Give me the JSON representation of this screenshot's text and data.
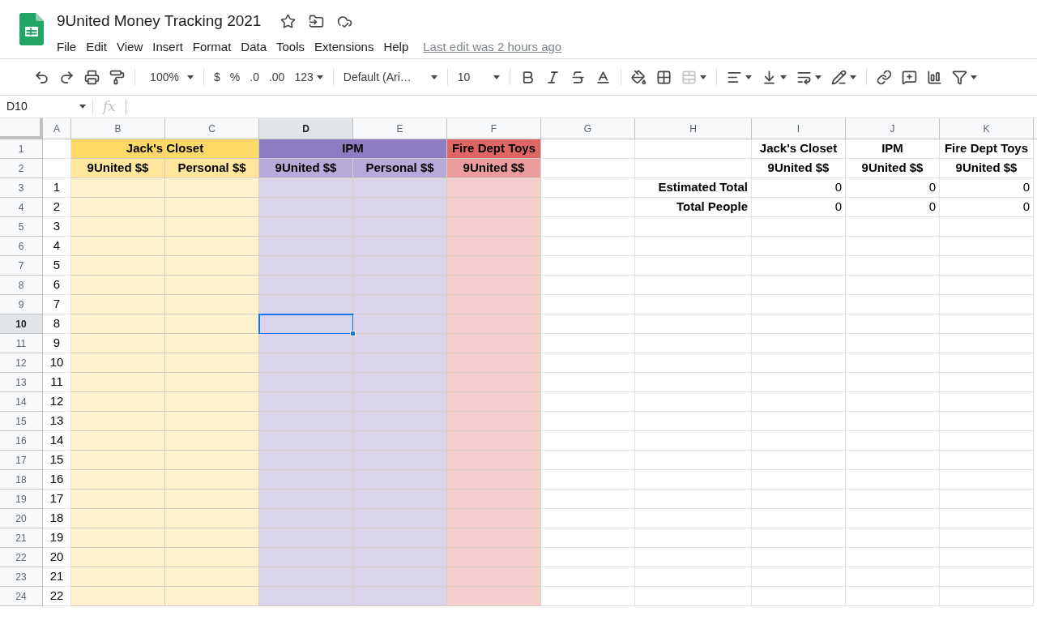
{
  "document": {
    "title": "9United Money Tracking 2021",
    "last_edit": "Last edit was 2 hours ago"
  },
  "menu": [
    "File",
    "Edit",
    "View",
    "Insert",
    "Format",
    "Data",
    "Tools",
    "Extensions",
    "Help"
  ],
  "toolbar": {
    "zoom": "100%",
    "currency": "$",
    "percent": "%",
    "decrease_decimals": ".0",
    "increase_decimals": ".00",
    "number_format": "123",
    "font": "Default (Ari…",
    "font_size": "10"
  },
  "formula_bar": {
    "cell_reference": "D10",
    "function_label": "fx"
  },
  "columns": [
    {
      "letter": "A",
      "selected": false
    },
    {
      "letter": "B",
      "selected": false
    },
    {
      "letter": "C",
      "selected": false
    },
    {
      "letter": "D",
      "selected": true
    },
    {
      "letter": "E",
      "selected": false
    },
    {
      "letter": "F",
      "selected": false
    },
    {
      "letter": "G",
      "selected": false
    },
    {
      "letter": "H",
      "selected": false
    },
    {
      "letter": "I",
      "selected": false
    },
    {
      "letter": "J",
      "selected": false
    },
    {
      "letter": "K",
      "selected": false
    }
  ],
  "bands": [
    {
      "title": "Jack's Closet",
      "color": "#ffd966",
      "headers": [
        "9United $$",
        "Personal $$"
      ]
    },
    {
      "title": "IPM",
      "color": "#8e7cc3",
      "headers": [
        "9United $$",
        "Personal $$"
      ]
    },
    {
      "title": "Fire Dept Toys",
      "color": "#e06666",
      "headers": [
        "9United $$"
      ]
    }
  ],
  "rows": [
    {
      "number": "1",
      "selected": false,
      "cells": {
        "I": {
          "text": "Jack's Closet",
          "bold": true
        },
        "J": {
          "text": "IPM",
          "bold": true
        },
        "K": {
          "text": "Fire Dept Toys",
          "bold": true
        }
      }
    },
    {
      "number": "2",
      "selected": false,
      "cells": {
        "I": {
          "text": "9United $$",
          "bold": true
        },
        "J": {
          "text": "9United $$",
          "bold": true
        },
        "K": {
          "text": "9United $$",
          "bold": true
        }
      }
    },
    {
      "number": "3",
      "selected": false,
      "cells": {
        "A": {
          "text": "1",
          "bold": false
        },
        "H": {
          "text": "Estimated Total",
          "bold": true
        },
        "I": {
          "text": "0",
          "bold": false
        },
        "J": {
          "text": "0",
          "bold": false
        },
        "K": {
          "text": "0",
          "bold": false
        }
      }
    },
    {
      "number": "4",
      "selected": false,
      "cells": {
        "A": {
          "text": "2",
          "bold": false
        },
        "H": {
          "text": "Total People",
          "bold": true
        },
        "I": {
          "text": "0",
          "bold": false
        },
        "J": {
          "text": "0",
          "bold": false
        },
        "K": {
          "text": "0",
          "bold": false
        }
      }
    },
    {
      "number": "5",
      "selected": false,
      "cells": {
        "A": {
          "text": "3",
          "bold": false
        }
      }
    },
    {
      "number": "6",
      "selected": false,
      "cells": {
        "A": {
          "text": "4",
          "bold": false
        }
      }
    },
    {
      "number": "7",
      "selected": false,
      "cells": {
        "A": {
          "text": "5",
          "bold": false
        }
      }
    },
    {
      "number": "8",
      "selected": false,
      "cells": {
        "A": {
          "text": "6",
          "bold": false
        }
      }
    },
    {
      "number": "9",
      "selected": false,
      "cells": {
        "A": {
          "text": "7",
          "bold": false
        }
      }
    },
    {
      "number": "10",
      "selected": true,
      "cells": {
        "A": {
          "text": "8",
          "bold": false
        }
      }
    },
    {
      "number": "11",
      "selected": false,
      "cells": {
        "A": {
          "text": "9",
          "bold": false
        }
      }
    },
    {
      "number": "12",
      "selected": false,
      "cells": {
        "A": {
          "text": "10",
          "bold": false
        }
      }
    },
    {
      "number": "13",
      "selected": false,
      "cells": {
        "A": {
          "text": "11",
          "bold": false
        }
      }
    },
    {
      "number": "14",
      "selected": false,
      "cells": {
        "A": {
          "text": "12",
          "bold": false
        }
      }
    },
    {
      "number": "15",
      "selected": false,
      "cells": {
        "A": {
          "text": "13",
          "bold": false
        }
      }
    },
    {
      "number": "16",
      "selected": false,
      "cells": {
        "A": {
          "text": "14",
          "bold": false
        }
      }
    },
    {
      "number": "17",
      "selected": false,
      "cells": {
        "A": {
          "text": "15",
          "bold": false
        }
      }
    },
    {
      "number": "18",
      "selected": false,
      "cells": {
        "A": {
          "text": "16",
          "bold": false
        }
      }
    },
    {
      "number": "19",
      "selected": false,
      "cells": {
        "A": {
          "text": "17",
          "bold": false
        }
      }
    },
    {
      "number": "20",
      "selected": false,
      "cells": {
        "A": {
          "text": "18",
          "bold": false
        }
      }
    },
    {
      "number": "21",
      "selected": false,
      "cells": {
        "A": {
          "text": "19",
          "bold": false
        }
      }
    },
    {
      "number": "22",
      "selected": false,
      "cells": {
        "A": {
          "text": "20",
          "bold": false
        }
      }
    },
    {
      "number": "23",
      "selected": false,
      "cells": {
        "A": {
          "text": "21",
          "bold": false
        }
      }
    },
    {
      "number": "24",
      "selected": false,
      "cells": {
        "A": {
          "text": "22",
          "bold": false
        }
      }
    }
  ]
}
